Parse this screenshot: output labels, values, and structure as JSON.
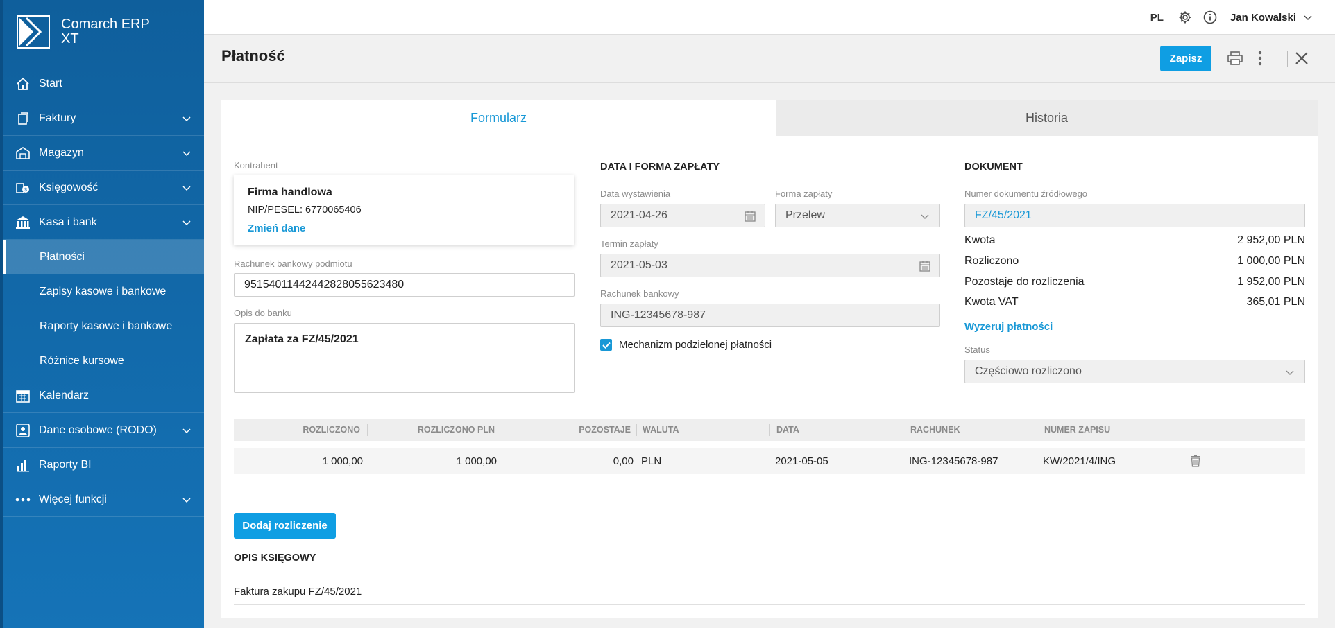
{
  "app": {
    "logo_line1": "Comarch ERP",
    "logo_line2": "XT"
  },
  "sidebar": {
    "items": [
      {
        "label": "Start",
        "icon": "home-icon",
        "chevron": false
      },
      {
        "label": "Faktury",
        "icon": "invoice-icon",
        "chevron": true
      },
      {
        "label": "Magazyn",
        "icon": "warehouse-icon",
        "chevron": true
      },
      {
        "label": "Księgowość",
        "icon": "accounting-icon",
        "chevron": true
      },
      {
        "label": "Kasa i bank",
        "icon": "bank-icon",
        "chevron": true
      }
    ],
    "subitems": [
      {
        "label": "Płatności",
        "active": true
      },
      {
        "label": "Zapisy kasowe i bankowe"
      },
      {
        "label": "Raporty kasowe i bankowe"
      },
      {
        "label": "Różnice kursowe"
      }
    ],
    "items_after": [
      {
        "label": "Kalendarz",
        "icon": "calendar-icon",
        "chevron": false
      },
      {
        "label": "Dane osobowe (RODO)",
        "icon": "person-icon",
        "chevron": true
      },
      {
        "label": "Raporty BI",
        "icon": "chart-icon",
        "chevron": false
      },
      {
        "label": "Więcej funkcji",
        "icon": "more-dots-icon",
        "chevron": true
      }
    ]
  },
  "topbar": {
    "lang": "PL",
    "user": "Jan Kowalski"
  },
  "header": {
    "title": "Płatność",
    "save_label": "Zapisz"
  },
  "tabs": {
    "form": "Formularz",
    "history": "Historia"
  },
  "contractor": {
    "label": "Kontrahent",
    "name": "Firma handlowa",
    "nip": "NIP/PESEL: 6770065406",
    "change_link": "Zmień dane"
  },
  "bank_account": {
    "label": "Rachunek bankowy podmiotu",
    "value": "95154011442442828055623480"
  },
  "bank_description": {
    "label": "Opis do banku",
    "value": "Zapłata za FZ/45/2021"
  },
  "payment": {
    "section_title": "DATA I FORMA ZAPŁATY",
    "issue_date_label": "Data wystawienia",
    "issue_date": "2021-04-26",
    "payment_form_label": "Forma zapłaty",
    "payment_form": "Przelew",
    "due_date_label": "Termin zapłaty",
    "due_date": "2021-05-03",
    "bank_label": "Rachunek bankowy",
    "bank": "ING-12345678-987",
    "split_payment_label": "Mechanizm podzielonej płatności",
    "split_payment_checked": true
  },
  "document": {
    "section_title": "DOKUMENT",
    "source_number_label": "Numer dokumentu źródłowego",
    "source_number": "FZ/45/2021",
    "amount_label": "Kwota",
    "amount": "2 952,00 PLN",
    "settled_label": "Rozliczono",
    "settled": "1 000,00 PLN",
    "remaining_label": "Pozostaje do rozliczenia",
    "remaining": "1 952,00 PLN",
    "vat_label": "Kwota VAT",
    "vat": "365,01 PLN",
    "reset_link": "Wyzeruj płatności",
    "status_label": "Status",
    "status": "Częściowo rozliczono"
  },
  "table": {
    "headers": {
      "settled": "ROZLICZONO",
      "settled_pln": "ROZLICZONO PLN",
      "remaining": "POZOSTAJE",
      "currency": "WALUTA",
      "date": "DATA",
      "account": "RACHUNEK",
      "entry_number": "NUMER ZAPISU"
    },
    "rows": [
      {
        "settled": "1 000,00",
        "settled_pln": "1 000,00",
        "remaining": "0,00",
        "currency": "PLN",
        "date": "2021-05-05",
        "account": "ING-12345678-987",
        "entry_number": "KW/2021/4/ING"
      }
    ]
  },
  "add_settlement_label": "Dodaj rozliczenie",
  "accounting": {
    "title": "OPIS KSIĘGOWY",
    "text": "Faktura zakupu FZ/45/2021"
  },
  "colors": {
    "sidebar": "#1573b7",
    "accent": "#0f9ee3",
    "link": "#1898d6"
  }
}
